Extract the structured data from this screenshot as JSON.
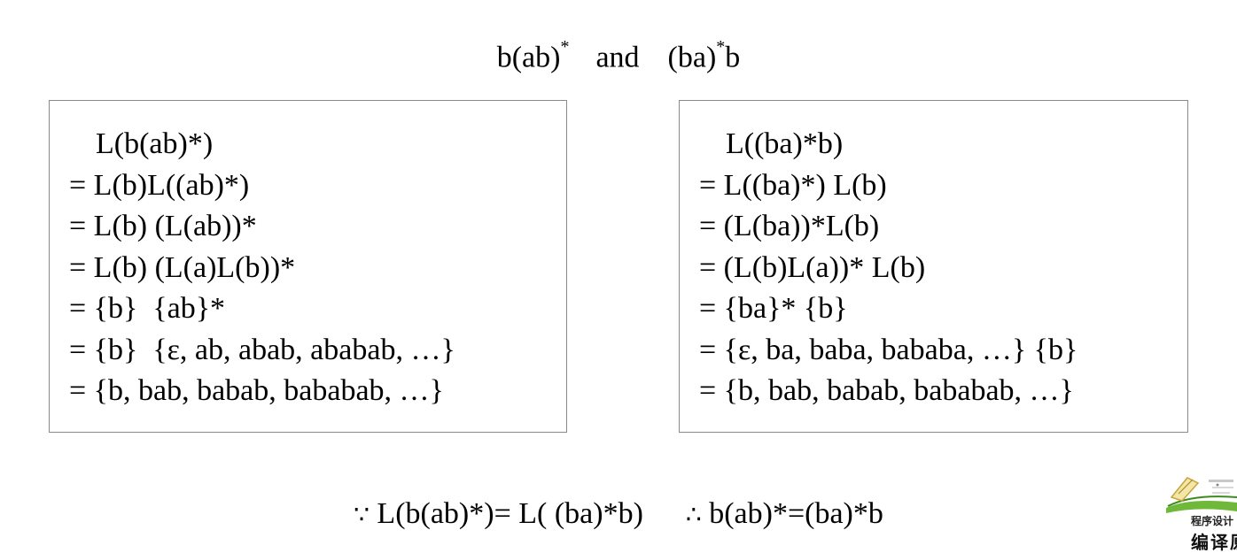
{
  "title": {
    "left_expr": "b(ab)",
    "left_sup": "*",
    "connector": "and",
    "right_expr": "(ba)",
    "right_sup": "*",
    "right_suffix": "b"
  },
  "left_box": {
    "lines": [
      "L(b(ab)*)",
      "= L(b)L((ab)*)",
      "= L(b) (L(ab))*",
      "= L(b) (L(a)L(b))*",
      "= {b}  {ab}*",
      "= {b}  {ε, ab, abab, ababab, …}",
      "= {b, bab, babab, bababab, …}"
    ]
  },
  "right_box": {
    "lines": [
      "L((ba)*b)",
      "= L((ba)*) L(b)",
      "= (L(ba))*L(b)",
      "= (L(b)L(a))* L(b)",
      "= {ba}* {b}",
      "= {ε, ba, baba, bababa, …} {b}",
      "= {b, bab, babab, bababab, …}"
    ]
  },
  "conclusion": {
    "because_symbol": "∵",
    "because_text": "L(b(ab)*)= L( (ba)*b)",
    "therefore_symbol": "∴",
    "therefore_text": "b(ab)*=(ba)*b"
  },
  "logo": {
    "line1": "程序设计",
    "line2": "编译原"
  }
}
